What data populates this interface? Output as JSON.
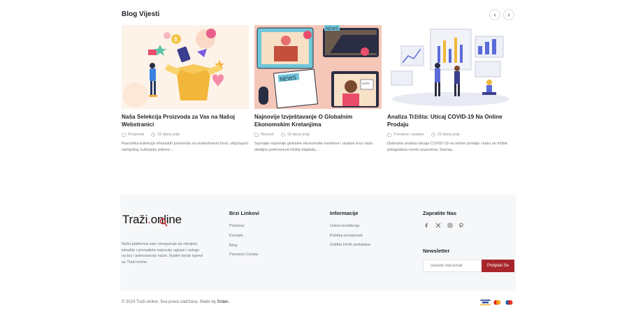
{
  "blog": {
    "title": "Blog Vijesti",
    "prev": "‹",
    "next": "›",
    "posts": [
      {
        "title": "Naša Selekcija Proizvoda za Vas na Našoj Webstranici",
        "category": "Proizvodi",
        "date": "15 dana prije",
        "excerpt": "Raznolika kolekcija vrhunskih proizvoda za svakodnevni život, uključujući namještaj, kuhinjske pribore..."
      },
      {
        "title": "Najnovije Izvještavanje O Globalnim Ekonomskim Kretanjima",
        "category": "Novosti",
        "date": "15 dana prije",
        "excerpt": "Saznajte najnovije globalne ekonomske trendove i analize kroz našu detaljnu pokrivenost tržišta kapitala,..."
      },
      {
        "title": "Analiza Tržišta: Uticaj COVID-19 Na Online Prodaju",
        "category": "Trendovi i analize",
        "date": "15 dana prije",
        "excerpt": "Dubinska analiza uticaja COVID-19 na online prodaju i kako se tržište prilagođava novim izazovima. Saznaj..."
      }
    ]
  },
  "footer": {
    "logo_main": "Traži",
    "logo_dot": ".",
    "logo_tld": "online",
    "description": "Naša platforma vam omogućuje da otkrijete, istražite i pronađete najnovije oglase i usluge na brz i jednostavan način. Budite korak ispred uz Traži.online.",
    "quick_links_title": "Brzi Linkovi",
    "quick_links": [
      "Početna",
      "Kontakt",
      "Blog",
      "Pomoćni Centar"
    ],
    "info_title": "Informacije",
    "info_links": [
      "Uslovi korištenja",
      "Politika privatnosti",
      "Zaštita ličnih podataka"
    ],
    "follow_title": "Zapratite Nas",
    "social_icons": [
      "facebook-icon",
      "x-icon",
      "instagram-icon",
      "pinterest-icon"
    ],
    "newsletter_title": "Newsletter",
    "newsletter_placeholder": "Unesite Vaš Email",
    "newsletter_button": "Pretplati Se"
  },
  "bottom": {
    "copyright": "© 2024 Traži.online. Sva prava zadržana. Made by",
    "author": "Srdan.",
    "payment_methods": [
      "visa",
      "mastercard",
      "maestro"
    ]
  },
  "colors": {
    "accent": "#a8262b",
    "footer_bg": "#f6f7f9",
    "card1_bg": "#fdf3e8",
    "card2_bg": "#f4c7b8",
    "card3_bg": "#ffffff"
  }
}
